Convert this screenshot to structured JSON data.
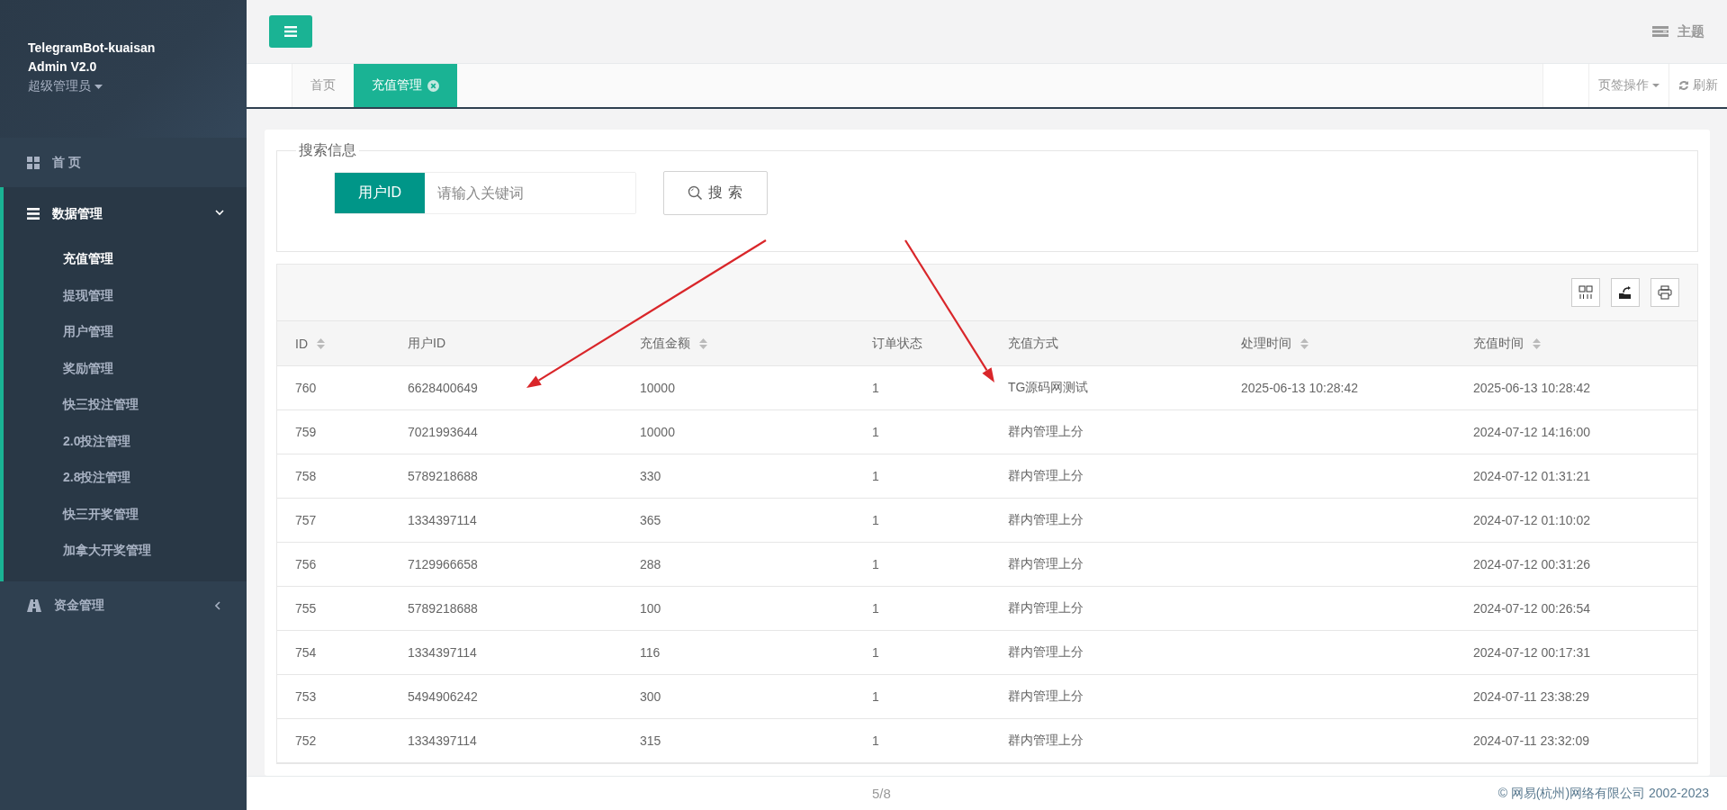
{
  "sidebar": {
    "brand_lines": [
      "TelegramBot-kuaisan",
      "Admin V2.0"
    ],
    "role": "超级管理员",
    "items": [
      {
        "label": "首 页",
        "kind": "link",
        "expanded": false
      },
      {
        "label": "数据管理",
        "kind": "group",
        "expanded": true,
        "children": [
          {
            "label": "充值管理",
            "selected": true
          },
          {
            "label": "提现管理",
            "selected": false
          },
          {
            "label": "用户管理",
            "selected": false
          },
          {
            "label": "奖励管理",
            "selected": false
          },
          {
            "label": "快三投注管理",
            "selected": false
          },
          {
            "label": "2.0投注管理",
            "selected": false
          },
          {
            "label": "2.8投注管理",
            "selected": false
          },
          {
            "label": "快三开奖管理",
            "selected": false
          },
          {
            "label": "加拿大开奖管理",
            "selected": false
          }
        ]
      },
      {
        "label": "资金管理",
        "kind": "group",
        "expanded": false
      }
    ]
  },
  "header": {
    "theme_label": "主题"
  },
  "tabs": [
    {
      "label": "首页",
      "selected": false,
      "closable": false
    },
    {
      "label": "充值管理",
      "selected": true,
      "closable": true
    }
  ],
  "tab_actions": {
    "menu_label": "页签操作",
    "refresh_label": "刷新"
  },
  "search": {
    "legend": "搜索信息",
    "field_label": "用户ID",
    "placeholder": "请输入关键词",
    "button_label": "搜 索"
  },
  "table": {
    "columns": [
      {
        "label": "ID",
        "sortable": true
      },
      {
        "label": "用户ID",
        "sortable": false
      },
      {
        "label": "充值金额",
        "sortable": true
      },
      {
        "label": "订单状态",
        "sortable": false
      },
      {
        "label": "充值方式",
        "sortable": false
      },
      {
        "label": "处理时间",
        "sortable": true
      },
      {
        "label": "充值时间",
        "sortable": true
      }
    ],
    "rows": [
      [
        "760",
        "6628400649",
        "10000",
        "1",
        "TG源码网测试",
        "2025-06-13 10:28:42",
        "2025-06-13 10:28:42"
      ],
      [
        "759",
        "7021993644",
        "10000",
        "1",
        "群内管理上分",
        "",
        "2024-07-12 14:16:00"
      ],
      [
        "758",
        "5789218688",
        "330",
        "1",
        "群内管理上分",
        "",
        "2024-07-12 01:31:21"
      ],
      [
        "757",
        "1334397114",
        "365",
        "1",
        "群内管理上分",
        "",
        "2024-07-12 01:10:02"
      ],
      [
        "756",
        "7129966658",
        "288",
        "1",
        "群内管理上分",
        "",
        "2024-07-12 00:31:26"
      ],
      [
        "755",
        "5789218688",
        "100",
        "1",
        "群内管理上分",
        "",
        "2024-07-12 00:26:54"
      ],
      [
        "754",
        "1334397114",
        "116",
        "1",
        "群内管理上分",
        "",
        "2024-07-12 00:17:31"
      ],
      [
        "753",
        "5494906242",
        "300",
        "1",
        "群内管理上分",
        "",
        "2024-07-11 23:38:29"
      ],
      [
        "752",
        "1334397114",
        "315",
        "1",
        "群内管理上分",
        "",
        "2024-07-11 23:32:09"
      ]
    ]
  },
  "footer": {
    "page_indicator": "5/8",
    "copyright": "© 网易(杭州)网络有限公司 2002-2023"
  },
  "annotations": [
    {
      "kind": "arrow"
    },
    {
      "kind": "arrow"
    }
  ]
}
